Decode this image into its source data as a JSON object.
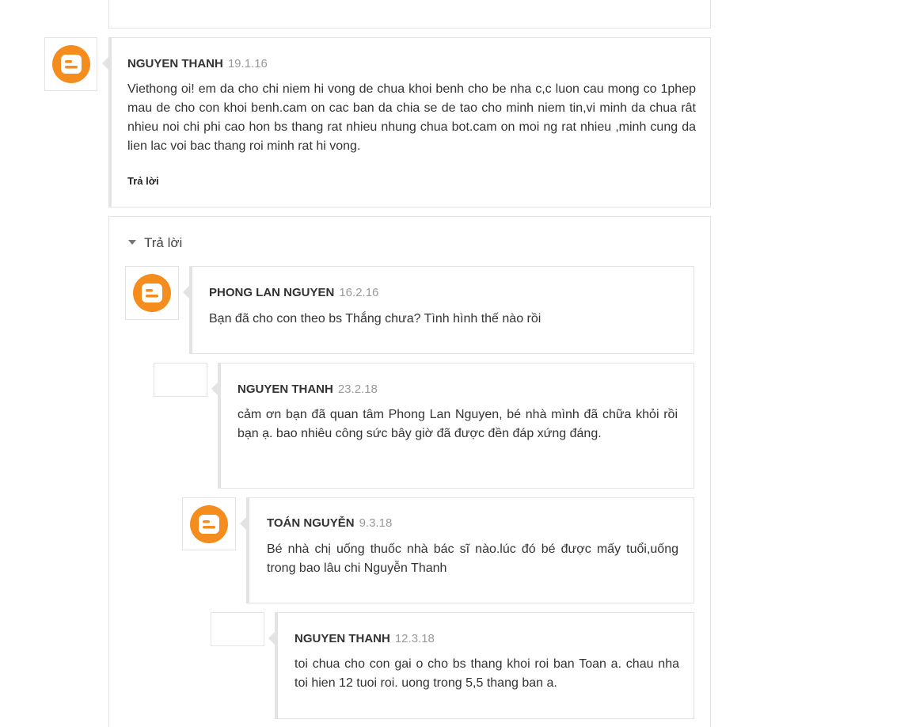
{
  "comments": [
    {
      "author": "NGUYEN THANH",
      "date": "19.1.16",
      "text": "Viethong oi! em da cho chi niem hi vong de chua khoi benh cho be nha c,c luon cau mong co 1phep mau de cho con khoi benh.cam on cac ban da chia se de tao cho minh niem tin,vi minh da chua rât nhieu noi chi phi cao hon bs thang rat nhieu nhung chua bot.cam on moi ng rat nhieu ,minh cung da lien lac voi bac thang roi minh rat hi vong.",
      "reply_label": "Trả lời"
    }
  ],
  "thread": {
    "toggle_label": "Trả lời",
    "replies": [
      {
        "author": "PHONG LAN NGUYEN",
        "date": "16.2.16",
        "text": "Bạn đã cho con theo bs Thắng chưa? Tình hình thế nào rồi"
      },
      {
        "author": "NGUYEN THANH",
        "date": "23.2.18",
        "text": "cảm ơn bạn đã quan tâm Phong Lan Nguyen, bé nhà mình đã chữa khỏi rồi bạn ạ. bao nhiêu công sức bây giờ đã được đền đáp xứng đáng."
      },
      {
        "author": "TOÁN NGUYỄN",
        "date": "9.3.18",
        "text": "Bé nhà chị uống thuốc nhà bác sĩ nào.lúc đó bé được mấy tuổi,uống trong bao lâu chi Nguyễn Thanh"
      },
      {
        "author": "NGUYEN THANH",
        "date": "12.3.18",
        "text": "toi chua cho con gai o cho bs thang khoi roi ban Toan a. chau nha toi hien 12 tuoi roi. uong trong 5,5 thang ban a."
      }
    ]
  },
  "colors": {
    "blogger_orange": "#f48d1d",
    "border": "#e3e3e3",
    "date_grey": "#999999"
  },
  "icons": {
    "avatar": "blogger-logo-icon",
    "toggle": "caret-down-icon"
  }
}
